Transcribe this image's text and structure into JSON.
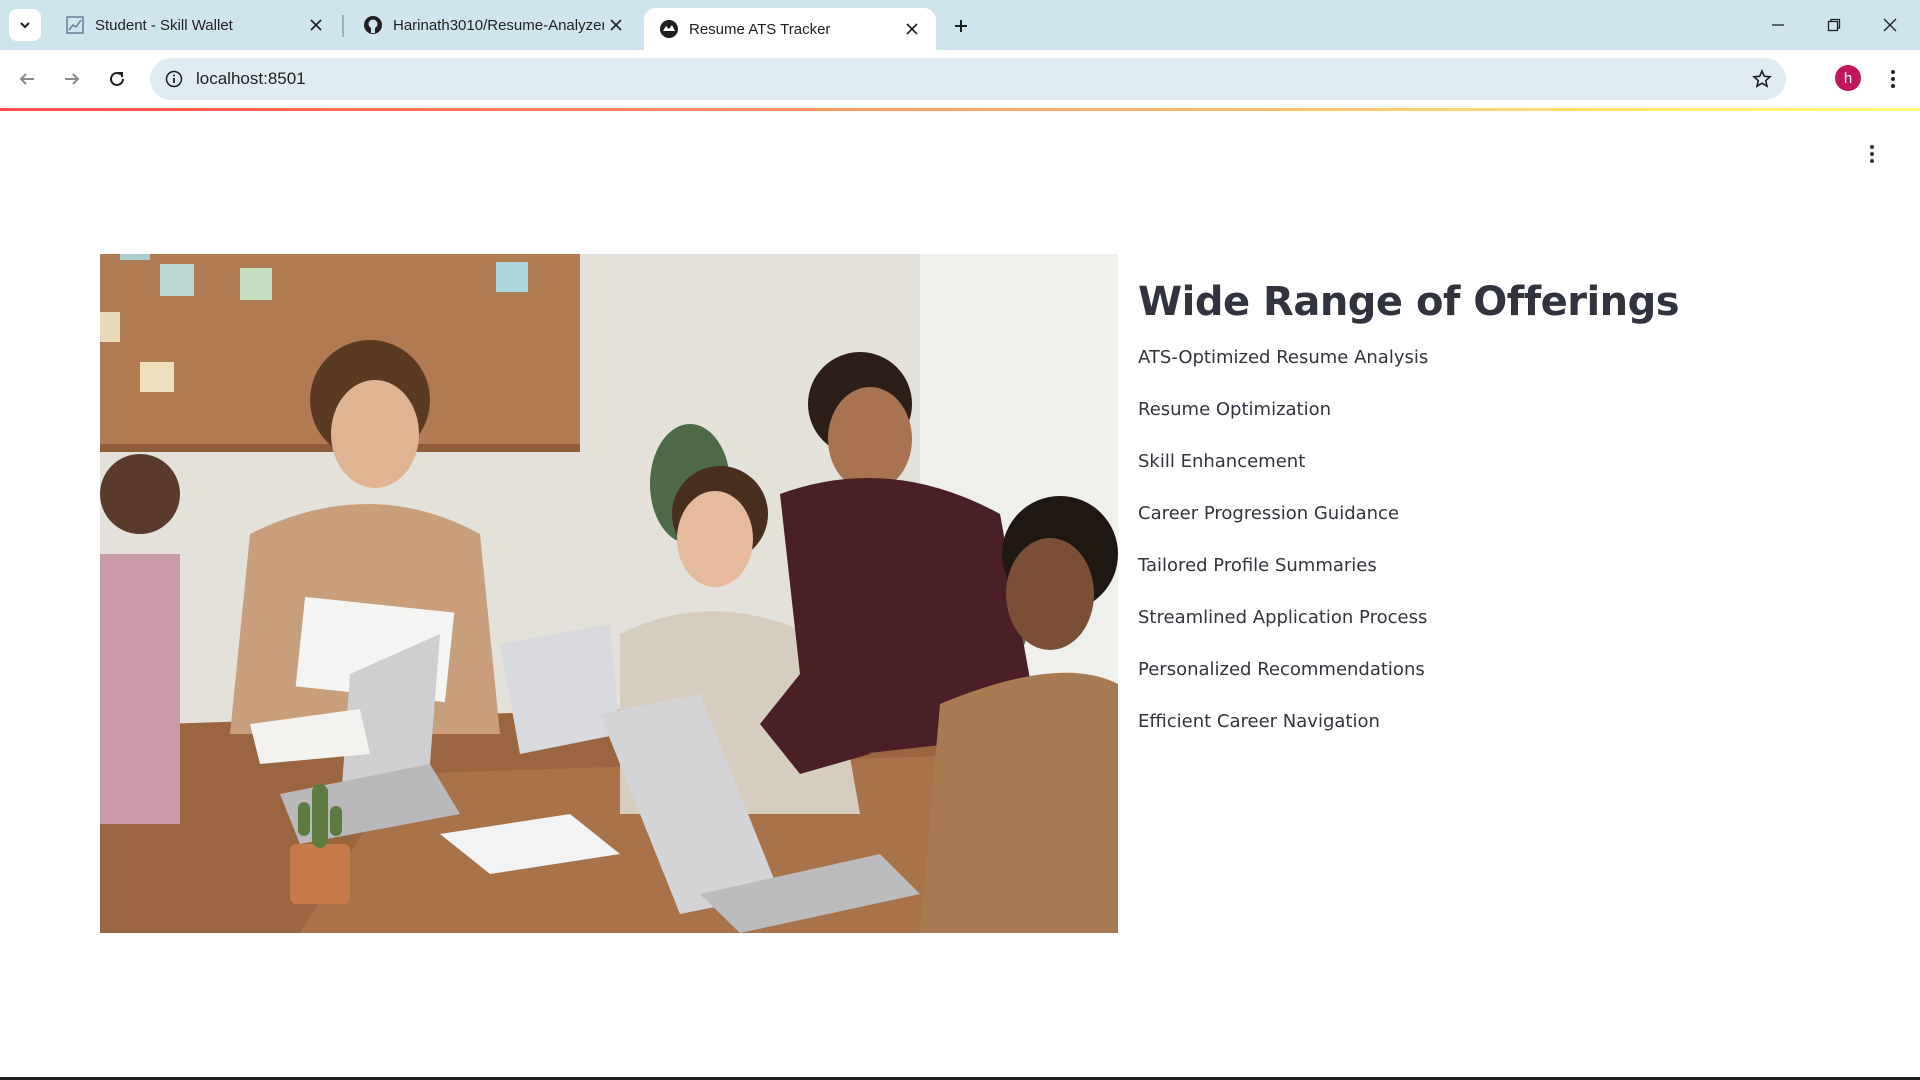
{
  "browser": {
    "tabs": [
      {
        "title": "Student - Skill Wallet",
        "icon": "chart-icon",
        "active": false
      },
      {
        "title": "Harinath3010/Resume-Analyzer",
        "icon": "github-icon",
        "active": false
      },
      {
        "title": "Resume ATS Tracker",
        "icon": "streamlit-icon",
        "active": true
      }
    ],
    "url": "localhost:8501",
    "profile_initial": "h",
    "accent_colors": {
      "tabstrip": "#cfe5ee",
      "omnibox": "#dfecf1",
      "avatar": "#c2185b"
    }
  },
  "page": {
    "heading": "Wide Range of Offerings",
    "offerings": [
      "ATS-Optimized Resume Analysis",
      "Resume Optimization",
      "Skill Enhancement",
      "Career Progression Guidance",
      "Tailored Profile Summaries",
      "Streamlined Application Process",
      "Personalized Recommendations",
      "Efficient Career Navigation"
    ],
    "image": "team-meeting-photo",
    "colors": {
      "text": "#31333f",
      "decoration_start": "#ff4b4b",
      "decoration_end": "#fffd80"
    }
  }
}
